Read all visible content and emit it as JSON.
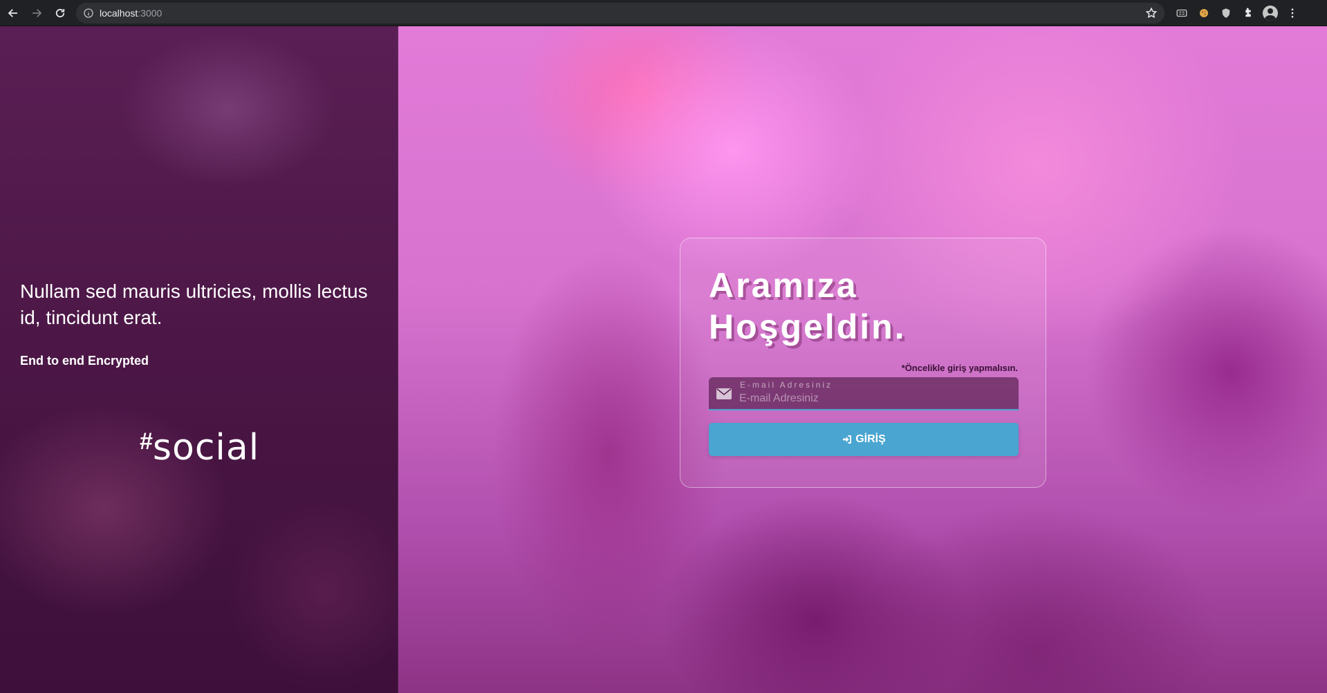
{
  "browser": {
    "url_host": "localhost",
    "url_port": ":3000",
    "icons": [
      "back-icon",
      "forward-icon",
      "reload-icon",
      "info-icon",
      "star-icon",
      "reader-mode-icon",
      "cookie-extension-icon",
      "shield-extension-icon",
      "extensions-puzzle-icon",
      "profile-avatar-icon",
      "menu-dots-icon"
    ]
  },
  "left_panel": {
    "tagline": "Nullam sed mauris ultricies, mollis lectus id, tincidunt erat.",
    "encrypted": "End to end Encrypted",
    "logo_hash": "#",
    "logo_word": "social"
  },
  "login_card": {
    "title": "Aramıza Hoşgeldin.",
    "subnote": "*Öncelikle giriş yapmalısın.",
    "email_label": "E-mail Adresiniz",
    "email_placeholder": "E-mail Adresiniz",
    "email_value": "",
    "button_label": "GİRİŞ"
  },
  "colors": {
    "accent": "#4aa5d1",
    "left_panel": "#4e1848",
    "background": "#d773cf"
  }
}
